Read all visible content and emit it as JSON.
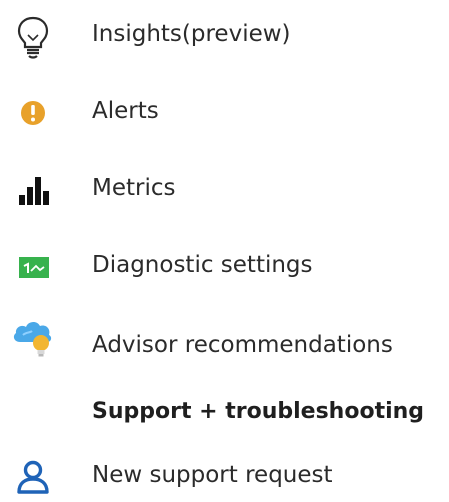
{
  "menu": {
    "items": [
      {
        "label": "Insights(preview)",
        "icon": "lightbulb-outline-icon"
      },
      {
        "label": "Alerts",
        "icon": "alert-icon"
      },
      {
        "label": "Metrics",
        "icon": "bar-chart-icon"
      },
      {
        "label": "Diagnostic settings",
        "icon": "diagnostic-settings-icon"
      },
      {
        "label": "Advisor recommendations",
        "icon": "cloud-lightbulb-icon"
      }
    ],
    "section_header": "Support + troubleshooting",
    "support_items": [
      {
        "label": "New support request",
        "icon": "person-icon"
      }
    ]
  },
  "colors": {
    "alert": "#e8a12a",
    "metrics_bars": "#111111",
    "diagnostic_green": "#37b24d",
    "cloud_blue": "#4aa8e8",
    "bulb_yellow": "#f2b632",
    "person_blue": "#1f63b7",
    "text": "#2b2b2b"
  }
}
